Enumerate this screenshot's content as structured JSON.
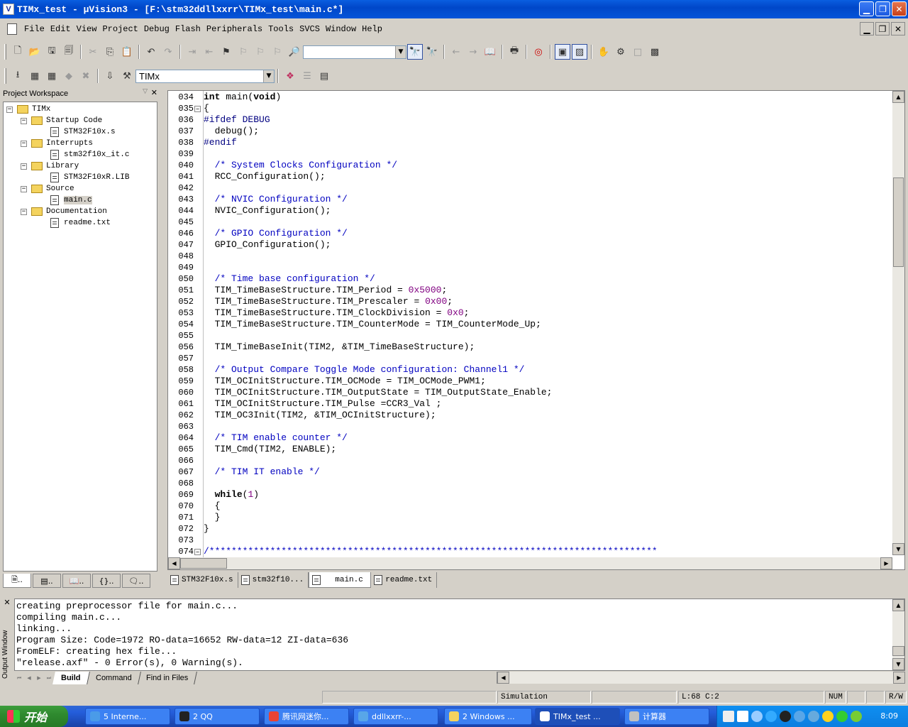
{
  "window": {
    "title": "TIMx_test  - μVision3 - [F:\\stm32ddllxxrr\\TIMx_test\\main.c*]",
    "app_icon": "V"
  },
  "menu": [
    "File",
    "Edit",
    "View",
    "Project",
    "Debug",
    "Flash",
    "Peripherals",
    "Tools",
    "SVCS",
    "Window",
    "Help"
  ],
  "toolbar2": {
    "target": "TIMx"
  },
  "workspace": {
    "title": "Project Workspace",
    "tree": [
      {
        "label": "TIMx",
        "kind": "root"
      },
      {
        "label": "Startup Code",
        "kind": "group"
      },
      {
        "label": "STM32F10x.s",
        "kind": "file"
      },
      {
        "label": "Interrupts",
        "kind": "group"
      },
      {
        "label": "stm32f10x_it.c",
        "kind": "file"
      },
      {
        "label": "Library",
        "kind": "group"
      },
      {
        "label": "STM32F10xR.LIB",
        "kind": "file"
      },
      {
        "label": "Source",
        "kind": "group"
      },
      {
        "label": "main.c",
        "kind": "file"
      },
      {
        "label": "Documentation",
        "kind": "group"
      },
      {
        "label": "readme.txt",
        "kind": "file"
      }
    ]
  },
  "editor": {
    "lines": [
      {
        "n": "034",
        "t": "int main(void)"
      },
      {
        "n": "035",
        "t": "{"
      },
      {
        "n": "036",
        "t": "#ifdef DEBUG"
      },
      {
        "n": "037",
        "t": "  debug();"
      },
      {
        "n": "038",
        "t": "#endif"
      },
      {
        "n": "039",
        "t": ""
      },
      {
        "n": "040",
        "t": "  /* System Clocks Configuration */"
      },
      {
        "n": "041",
        "t": "  RCC_Configuration();"
      },
      {
        "n": "042",
        "t": ""
      },
      {
        "n": "043",
        "t": "  /* NVIC Configuration */"
      },
      {
        "n": "044",
        "t": "  NVIC_Configuration();"
      },
      {
        "n": "045",
        "t": ""
      },
      {
        "n": "046",
        "t": "  /* GPIO Configuration */"
      },
      {
        "n": "047",
        "t": "  GPIO_Configuration();"
      },
      {
        "n": "048",
        "t": ""
      },
      {
        "n": "049",
        "t": ""
      },
      {
        "n": "050",
        "t": "  /* Time base configuration */"
      },
      {
        "n": "051",
        "t": "  TIM_TimeBaseStructure.TIM_Period = 0x5000;"
      },
      {
        "n": "052",
        "t": "  TIM_TimeBaseStructure.TIM_Prescaler = 0x00;"
      },
      {
        "n": "053",
        "t": "  TIM_TimeBaseStructure.TIM_ClockDivision = 0x0;"
      },
      {
        "n": "054",
        "t": "  TIM_TimeBaseStructure.TIM_CounterMode = TIM_CounterMode_Up;"
      },
      {
        "n": "055",
        "t": ""
      },
      {
        "n": "056",
        "t": "  TIM_TimeBaseInit(TIM2, &TIM_TimeBaseStructure);"
      },
      {
        "n": "057",
        "t": ""
      },
      {
        "n": "058",
        "t": "  /* Output Compare Toggle Mode configuration: Channel1 */"
      },
      {
        "n": "059",
        "t": "  TIM_OCInitStructure.TIM_OCMode = TIM_OCMode_PWM1;"
      },
      {
        "n": "060",
        "t": "  TIM_OCInitStructure.TIM_OutputState = TIM_OutputState_Enable;"
      },
      {
        "n": "061",
        "t": "  TIM_OCInitStructure.TIM_Pulse =CCR3_Val ;"
      },
      {
        "n": "062",
        "t": "  TIM_OC3Init(TIM2, &TIM_OCInitStructure);"
      },
      {
        "n": "063",
        "t": ""
      },
      {
        "n": "064",
        "t": "  /* TIM enable counter */"
      },
      {
        "n": "065",
        "t": "  TIM_Cmd(TIM2, ENABLE);"
      },
      {
        "n": "066",
        "t": ""
      },
      {
        "n": "067",
        "t": "  /* TIM IT enable */"
      },
      {
        "n": "068",
        "t": ""
      },
      {
        "n": "069",
        "t": "  while(1)"
      },
      {
        "n": "070",
        "t": "  {"
      },
      {
        "n": "071",
        "t": "  }"
      },
      {
        "n": "072",
        "t": "}"
      },
      {
        "n": "073",
        "t": ""
      },
      {
        "n": "074",
        "t": "/*********************************************************************************"
      }
    ],
    "tabs": [
      {
        "label": "STM32F10x.s",
        "active": false
      },
      {
        "label": "stm32f10...",
        "active": false
      },
      {
        "label": "main.c",
        "active": true
      },
      {
        "label": "readme.txt",
        "active": false
      }
    ]
  },
  "output": {
    "title": "Output Window",
    "lines": [
      "creating preprocessor file for main.c...",
      "compiling main.c...",
      "linking...",
      "Program Size: Code=1972 RO-data=16652 RW-data=12 ZI-data=636",
      "FromELF: creating hex file...",
      "\"release.axf\" - 0 Error(s), 0 Warning(s)."
    ],
    "tabs": [
      "Build",
      "Command",
      "Find in Files"
    ],
    "active_tab": "Build"
  },
  "status": {
    "mode": "Simulation",
    "position": "L:68 C:2",
    "num": "NUM",
    "rw": "R/W"
  },
  "taskbar": {
    "start": "开始",
    "items": [
      "5 Interne...",
      "2 QQ",
      "腾讯网迷你...",
      "ddllxxrr-...",
      "2 Windows ...",
      "TIMx_test ...",
      "计算器"
    ],
    "clock": "8:09"
  }
}
